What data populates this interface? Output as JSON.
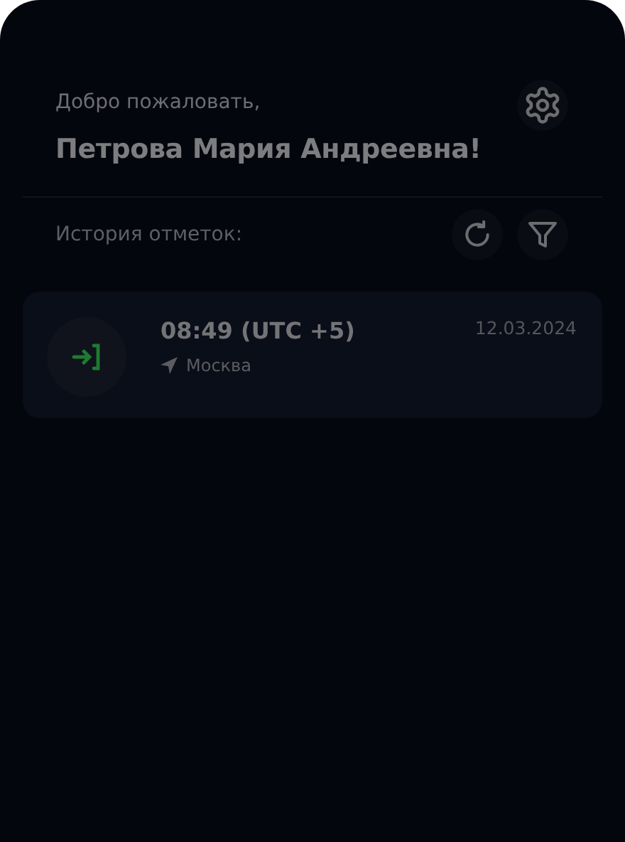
{
  "header": {
    "greeting": "Добро пожаловать,",
    "name": "Петрова Мария Андреевна!"
  },
  "history": {
    "title": "История отметок:"
  },
  "records": [
    {
      "kind": "in",
      "time": "08:49 (UTC +5)",
      "location": "Москва",
      "date": "12.03.2024"
    }
  ]
}
